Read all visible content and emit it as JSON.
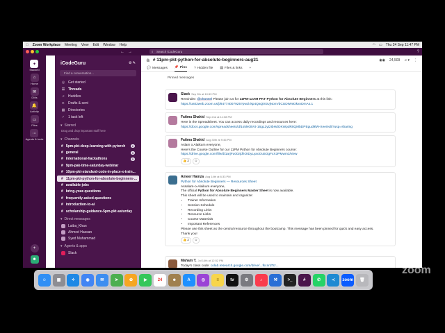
{
  "menubar": {
    "app": "Zoom Workplace",
    "items": [
      "Meeting",
      "View",
      "Edit",
      "Window",
      "Help"
    ],
    "clock": "Thu 24 Sep 11:47 PM"
  },
  "titlebar": {
    "search_placeholder": "Search iCodeGuru"
  },
  "rail": {
    "workspace_label": "Slacked",
    "items": [
      {
        "label": "Home",
        "glyph": "⌂"
      },
      {
        "label": "DMs",
        "glyph": "✉"
      },
      {
        "label": "Activity",
        "glyph": "🔔"
      },
      {
        "label": "Files",
        "glyph": "▭"
      },
      {
        "label": "Agents & tools",
        "glyph": "⋯"
      }
    ]
  },
  "sidebar": {
    "workspace": "iCodeGuru",
    "new_conversation": "Find a conversation...",
    "nav": [
      {
        "label": "Get started",
        "glyph": "◎"
      },
      {
        "label": "Threads",
        "glyph": "☰"
      },
      {
        "label": "Huddles",
        "glyph": "♫"
      },
      {
        "label": "Drafts & sent",
        "glyph": "➤"
      },
      {
        "label": "Directories",
        "glyph": "▦"
      },
      {
        "label": "1 task left",
        "glyph": "✓"
      }
    ],
    "starred_header": "Starred",
    "starred_hint": "Drag and drop important stuff here",
    "channels_header": "Channels",
    "channels": [
      {
        "name": "5pm-pkt-deep-learning-with-pytorch",
        "badge": "2"
      },
      {
        "name": "general",
        "badge": "3"
      },
      {
        "name": "international-hackathons",
        "badge": "2"
      },
      {
        "name": "9pm-pak-time-saturday-webinar",
        "badge": ""
      },
      {
        "name": "10pm-pkt-standard-code-in-place-x-train...",
        "badge": ""
      },
      {
        "name": "11pm-pkt-python-for-absolute-beginners-...",
        "badge": ""
      },
      {
        "name": "available-jobs",
        "badge": ""
      },
      {
        "name": "bring-your-questions",
        "badge": ""
      },
      {
        "name": "frequently-asked-questions",
        "badge": ""
      },
      {
        "name": "introduction-to-ai",
        "badge": ""
      },
      {
        "name": "scholarship-guidance-5pm-pkt-saturday",
        "badge": ""
      }
    ],
    "dm_header": "Direct messages",
    "dms": [
      "Laiba_Khan",
      "Ahmed Hassan",
      "Syed Muhammad"
    ],
    "apps_header": "Agents & apps",
    "apps": [
      "Slack"
    ]
  },
  "channel": {
    "name": "11pm-pkt-python-for-absolute-beginners-aug31",
    "member_count": "24,509",
    "tabs": [
      "Messages",
      "Pins",
      "Hidden file",
      "Files & links"
    ],
    "selected_tab": "Pins",
    "pinned_label": "Pinned messages"
  },
  "messages": [
    {
      "author": "Slack",
      "time": "Sep 9th at 10:59 PM",
      "color": "#4a154b",
      "line1a": "Reminder: ",
      "mention": "@channel",
      "line1b": " Please join us for ",
      "line1c": "11PM-12AM PKT Python for Absolute Beginners",
      "line1d": " at this link:",
      "link": "https://us02web.zoom.us/j/84774007925?pwd=kp4QaQ0XUjNonVbCUDIWeDkxnDmAs.1"
    },
    {
      "author": "Fatima Shahid",
      "time": "Sep 2nd at 11:08 PM",
      "color": "#b47a9e",
      "text": "Here is the Spreadsheet. You can access daily recordings and resources here:",
      "link": "https://docs.google.com/spreadsheets/d/1s5N0i5Vt-16gL2yt2IbHdOKWpdRtiQMbDPEgud9lW-Xee/edit?usp=sharing"
    },
    {
      "author": "Fatima Shahid",
      "time": "Aug 30th at 9:46 PM",
      "color": "#b47a9e",
      "text1": "Aslam o Alaikum everyone,",
      "text2": "Here's the Course Outline for our 11PM Python for Absolute Beginners course:",
      "link": "https://drive.google.com/file/d/1arjFu00zjdhOIDyLyaoOu5OgFxX3PMwm3/view",
      "reactions": [
        "👍 2",
        "☺"
      ]
    },
    {
      "author": "Ameer Hamza",
      "time": "Aug 14th at 6:33 PM",
      "color": "#3b6e8f",
      "link_title": "Python for Absolute Beginners — Resources Sheet",
      "greet": "Assalam-o-Alaikum everyone,",
      "intro_a": "The official ",
      "intro_b": "Python for Absolute Beginners Master Sheet",
      "intro_c": " is now available.",
      "intro2": "This sheet will be used to maintain and organize:",
      "bullets": [
        "Trainer Information",
        "Session Schedule",
        "Recording Links",
        "Resource Links",
        "Course Materials",
        "Important References"
      ],
      "footer": "Please use this sheet as the central resource throughout the bootcamp. This message has been pinned for quick and easy access.",
      "thanks": "Thank you!",
      "reactions": [
        "👍 2",
        "☺"
      ]
    },
    {
      "author": "Maham T.",
      "time": "Jul 14th at 12:52 PM",
      "color": "#8a5a3c",
      "text": "Today's class code: ",
      "link": "colab.research.google.com/drive/...fkcnrdTcr..."
    }
  ],
  "dock": [
    {
      "name": "finder",
      "color": "#2f8ff5",
      "glyph": "☺"
    },
    {
      "name": "launchpad",
      "color": "#8d8d93",
      "glyph": "▦"
    },
    {
      "name": "safari",
      "color": "#1e88e5",
      "glyph": "✧"
    },
    {
      "name": "chrome",
      "color": "#4285f4",
      "glyph": "◉"
    },
    {
      "name": "mail",
      "color": "#3d8ef0",
      "glyph": "✉"
    },
    {
      "name": "maps",
      "color": "#4caf50",
      "glyph": "➤"
    },
    {
      "name": "photos",
      "color": "#f6a623",
      "glyph": "✿"
    },
    {
      "name": "facetime",
      "color": "#34c759",
      "glyph": "▶"
    },
    {
      "name": "calendar",
      "color": "#ffffff",
      "glyph": "24"
    },
    {
      "name": "contacts",
      "color": "#a0804f",
      "glyph": "☻"
    },
    {
      "name": "app-store",
      "color": "#1e90ff",
      "glyph": "A"
    },
    {
      "name": "podcasts",
      "color": "#9b42d6",
      "glyph": "◎"
    },
    {
      "name": "notes",
      "color": "#f7d54a",
      "glyph": "≡"
    },
    {
      "name": "tv",
      "color": "#111111",
      "glyph": "tv"
    },
    {
      "name": "settings",
      "color": "#7a7a80",
      "glyph": "⚙"
    },
    {
      "name": "music",
      "color": "#fa3b4d",
      "glyph": "♪"
    },
    {
      "name": "xcode",
      "color": "#2a6fd6",
      "glyph": "⚒"
    },
    {
      "name": "terminal",
      "color": "#222222",
      "glyph": ">_"
    },
    {
      "name": "slack",
      "color": "#4a154b",
      "glyph": "#"
    },
    {
      "name": "whatsapp",
      "color": "#25d366",
      "glyph": "✆"
    },
    {
      "name": "vscode",
      "color": "#1f8ad2",
      "glyph": "≺"
    },
    {
      "name": "zoom",
      "color": "#0b5cff",
      "glyph": "zoom"
    },
    {
      "name": "trash",
      "color": "#b8b8bc",
      "glyph": "🗑"
    }
  ],
  "watermark": "zoom"
}
